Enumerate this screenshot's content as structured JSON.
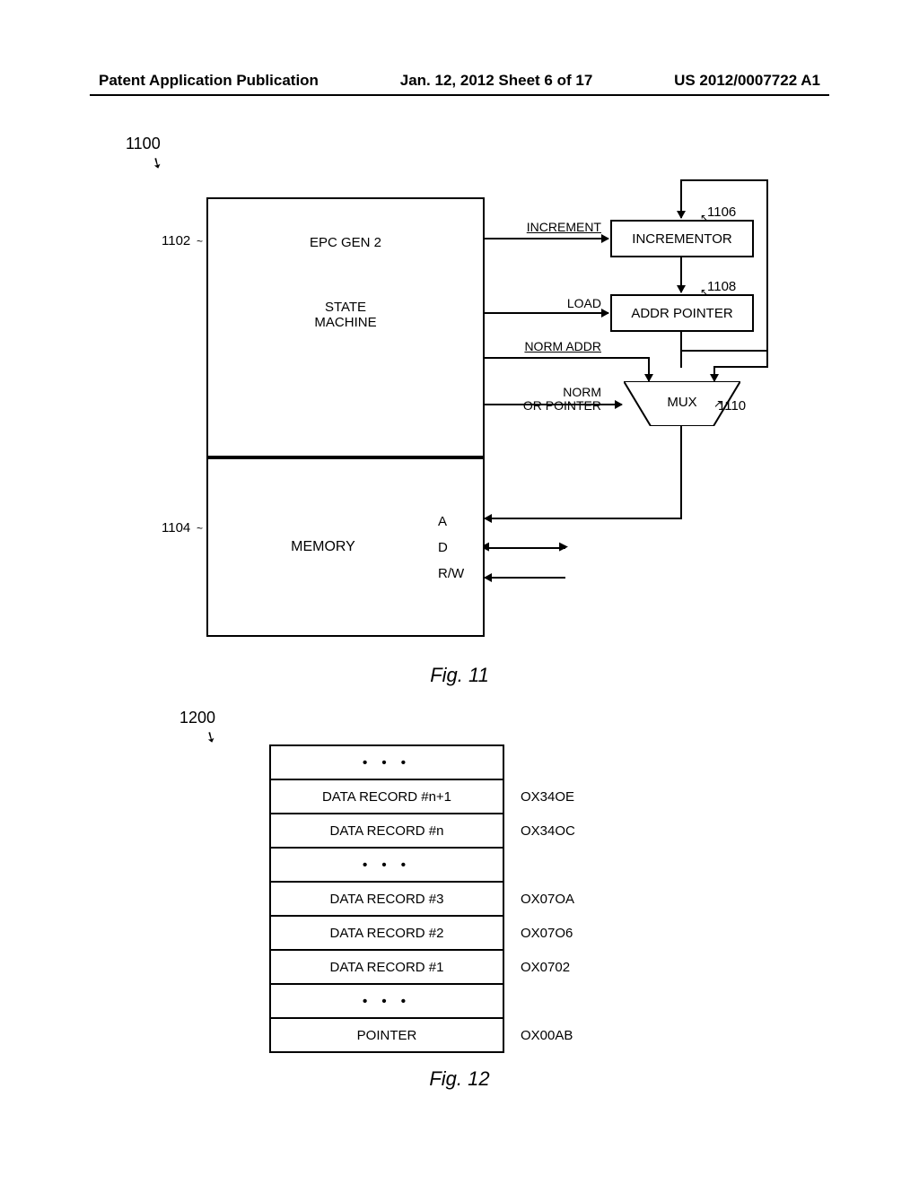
{
  "header": {
    "left": "Patent Application Publication",
    "mid": "Jan. 12, 2012   Sheet 6 of 17",
    "right": "US 2012/0007722 A1"
  },
  "fig11": {
    "ref_main": "1100",
    "ref_1102": "1102",
    "ref_1104": "1104",
    "ref_1106": "1106",
    "ref_1108": "1108",
    "ref_1110": "1110",
    "epc_title": "EPC GEN 2",
    "state_machine1": "STATE",
    "state_machine2": "MACHINE",
    "memory_label": "MEMORY",
    "port_a": "A",
    "port_d": "D",
    "port_rw": "R/W",
    "incrementor": "INCREMENTOR",
    "addr_pointer": "ADDR POINTER",
    "mux": "MUX",
    "sig_increment": "INCREMENT",
    "sig_load": "LOAD",
    "sig_normaddr": "NORM ADDR",
    "sig_normorptr1": "NORM",
    "sig_normorptr2": "OR POINTER",
    "caption": "Fig. 11"
  },
  "fig12": {
    "ref_main": "1200",
    "rows": [
      {
        "label": "•  •  •",
        "addr": "",
        "dots": true
      },
      {
        "label": "DATA RECORD #n+1",
        "addr": "OX34OE"
      },
      {
        "label": "DATA RECORD #n",
        "addr": "OX34OC"
      },
      {
        "label": "•  •  •",
        "addr": "",
        "dots": true
      },
      {
        "label": "DATA RECORD #3",
        "addr": "OX07OA"
      },
      {
        "label": "DATA RECORD #2",
        "addr": "OX07O6"
      },
      {
        "label": "DATA RECORD #1",
        "addr": "OX0702"
      },
      {
        "label": "•  •  •",
        "addr": "",
        "dots": true
      },
      {
        "label": "POINTER",
        "addr": "OX00AB"
      }
    ],
    "caption": "Fig. 12"
  }
}
